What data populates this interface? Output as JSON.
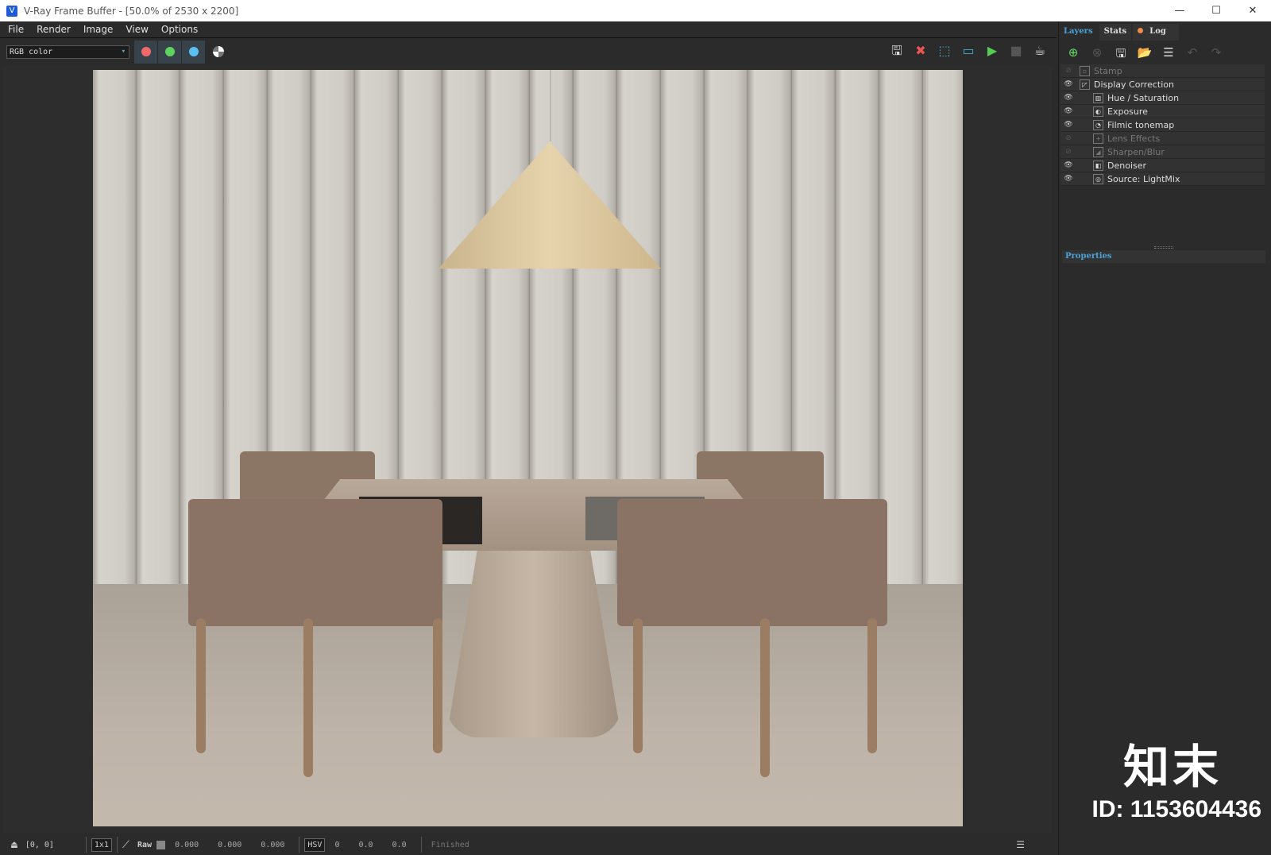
{
  "window": {
    "title": "V-Ray Frame Buffer - [50.0% of 2530 x 2200]"
  },
  "menu": [
    "File",
    "Render",
    "Image",
    "View",
    "Options"
  ],
  "toolbar": {
    "channel": "RGB color",
    "channel_buttons": [
      {
        "name": "red",
        "color": "#f06a6a"
      },
      {
        "name": "green",
        "color": "#5fd35f"
      },
      {
        "name": "blue",
        "color": "#5bc0f0"
      }
    ],
    "icons": [
      "save-image-icon",
      "clear-image-icon",
      "region-render-icon",
      "track-mouse-icon",
      "start-render-icon",
      "stop-render-icon",
      "render-icon"
    ]
  },
  "panel": {
    "tabs": [
      "Layers",
      "Stats",
      "Log"
    ],
    "layers": [
      {
        "label": "Stamp",
        "enabled": false,
        "indent": 0
      },
      {
        "label": "Display Correction",
        "enabled": true,
        "indent": 0
      },
      {
        "label": "Hue / Saturation",
        "enabled": true,
        "indent": 1
      },
      {
        "label": "Exposure",
        "enabled": true,
        "indent": 1
      },
      {
        "label": "Filmic tonemap",
        "enabled": true,
        "indent": 1
      },
      {
        "label": "Lens Effects",
        "enabled": false,
        "indent": 1
      },
      {
        "label": "Sharpen/Blur",
        "enabled": false,
        "indent": 1
      },
      {
        "label": "Denoiser",
        "enabled": true,
        "indent": 1
      },
      {
        "label": "Source: LightMix",
        "enabled": true,
        "indent": 1
      }
    ],
    "properties": "Properties"
  },
  "status": {
    "coords": "[0, 0]",
    "zoom": "1x1",
    "raw": "Raw",
    "rgb": [
      "0.000",
      "0.000",
      "0.000"
    ],
    "colorspace": "HSV",
    "hsv": [
      "0",
      "0.0",
      "0.0"
    ],
    "state": "Finished"
  },
  "watermark": {
    "logo": "知末",
    "id": "ID: 1153604436"
  }
}
